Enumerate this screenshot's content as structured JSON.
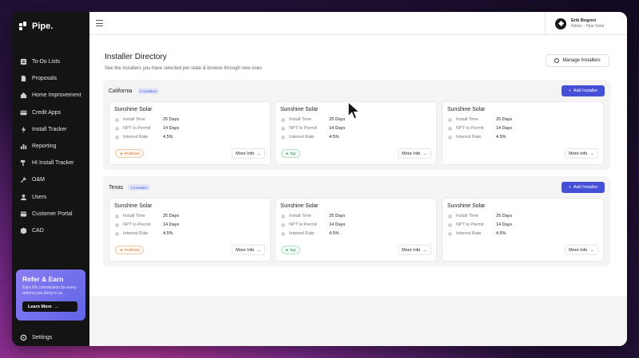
{
  "sidebar": {
    "logo": "Pipe.",
    "items": [
      {
        "label": "To-Do Lists",
        "icon": "list-icon"
      },
      {
        "label": "Proposals",
        "icon": "document-icon"
      },
      {
        "label": "Home Improvement",
        "icon": "home-icon"
      },
      {
        "label": "Credit Apps",
        "icon": "credit-card-icon"
      },
      {
        "label": "Install Tracker",
        "icon": "bolt-icon"
      },
      {
        "label": "Reporting",
        "icon": "chart-icon"
      },
      {
        "label": "HI Install Tracker",
        "icon": "hammer-icon"
      },
      {
        "label": "O&M",
        "icon": "wrench-icon"
      },
      {
        "label": "Users",
        "icon": "user-icon"
      },
      {
        "label": "Customer Portal",
        "icon": "portal-icon"
      },
      {
        "label": "CAD",
        "icon": "cube-icon"
      }
    ],
    "refer": {
      "title": "Refer & Earn",
      "text": "Earn 6% commission for every referral you bring to us",
      "button": "Learn More"
    },
    "settings": "Settings"
  },
  "header": {
    "user_name": "Erik Bogren",
    "user_role": "Admin - Pipe Solar"
  },
  "page": {
    "title": "Installer Directory",
    "subtitle": "See the installers you have selected per state & browse through new ones",
    "manage_button": "Manage Installers"
  },
  "groups": [
    {
      "state": "California",
      "count": "3 Installers",
      "add_button": "Add Installer",
      "cards": [
        {
          "name": "Sunshine Solar",
          "install_label": "Install Time",
          "install": "25 Days",
          "npt_label": "NPT to Permit",
          "npt": "14 Days",
          "rate_label": "Interest Rate",
          "rate": "4.5%",
          "tag": "Preffered",
          "tag_type": "preferred",
          "more": "More Info"
        },
        {
          "name": "Sunshine Solar",
          "install_label": "Install Time",
          "install": "25 Days",
          "npt_label": "NPT to Permit",
          "npt": "14 Days",
          "rate_label": "Interest Rate",
          "rate": "4.5%",
          "tag": "Top",
          "tag_type": "top",
          "more": "More Info"
        },
        {
          "name": "Sunshine Solar",
          "install_label": "Install Time",
          "install": "25 Days",
          "npt_label": "NPT to Permit",
          "npt": "14 Days",
          "rate_label": "Interest Rate",
          "rate": "4.5%",
          "tag": "",
          "tag_type": "",
          "more": "More Info"
        }
      ]
    },
    {
      "state": "Texas",
      "count": "3 Installers",
      "add_button": "Add Installer",
      "cards": [
        {
          "name": "Sunshine Solar",
          "install_label": "Install Time",
          "install": "25 Days",
          "npt_label": "NPT to Permit",
          "npt": "14 Days",
          "rate_label": "Interest Rate",
          "rate": "4.5%",
          "tag": "Preffered",
          "tag_type": "preferred",
          "more": "More Info"
        },
        {
          "name": "Sunshine Solar",
          "install_label": "Install Time",
          "install": "25 Days",
          "npt_label": "NPT to Permit",
          "npt": "14 Days",
          "rate_label": "Interest Rate",
          "rate": "4.5%",
          "tag": "Top",
          "tag_type": "top",
          "more": "More Info"
        },
        {
          "name": "Sunshine Solar",
          "install_label": "Install Time",
          "install": "25 Days",
          "npt_label": "NPT to Permit",
          "npt": "14 Days",
          "rate_label": "Interest Rate",
          "rate": "4.5%",
          "tag": "",
          "tag_type": "",
          "more": "More Info"
        }
      ]
    }
  ]
}
